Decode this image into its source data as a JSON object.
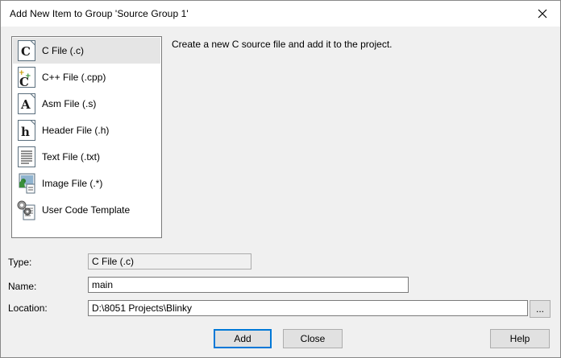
{
  "dialog": {
    "title": "Add New Item to Group 'Source Group 1'"
  },
  "file_types": [
    {
      "label": "C File (.c)",
      "icon": "c-file-icon",
      "selected": true
    },
    {
      "label": "C++ File (.cpp)",
      "icon": "cpp-file-icon",
      "selected": false
    },
    {
      "label": "Asm File (.s)",
      "icon": "asm-file-icon",
      "selected": false
    },
    {
      "label": "Header File (.h)",
      "icon": "header-file-icon",
      "selected": false
    },
    {
      "label": "Text File (.txt)",
      "icon": "text-file-icon",
      "selected": false
    },
    {
      "label": "Image File (.*)",
      "icon": "image-file-icon",
      "selected": false
    },
    {
      "label": "User Code Template",
      "icon": "user-code-template-icon",
      "selected": false
    }
  ],
  "description": "Create a new C source file and add it to the project.",
  "form": {
    "type_label": "Type:",
    "type_value": "C File (.c)",
    "name_label": "Name:",
    "name_value": "main",
    "location_label": "Location:",
    "location_value": "D:\\8051 Projects\\Blinky",
    "browse_label": "..."
  },
  "buttons": {
    "add": "Add",
    "close": "Close",
    "help": "Help"
  },
  "colors": {
    "selection": "#e5e5e5",
    "default_button_border": "#0078d7"
  }
}
